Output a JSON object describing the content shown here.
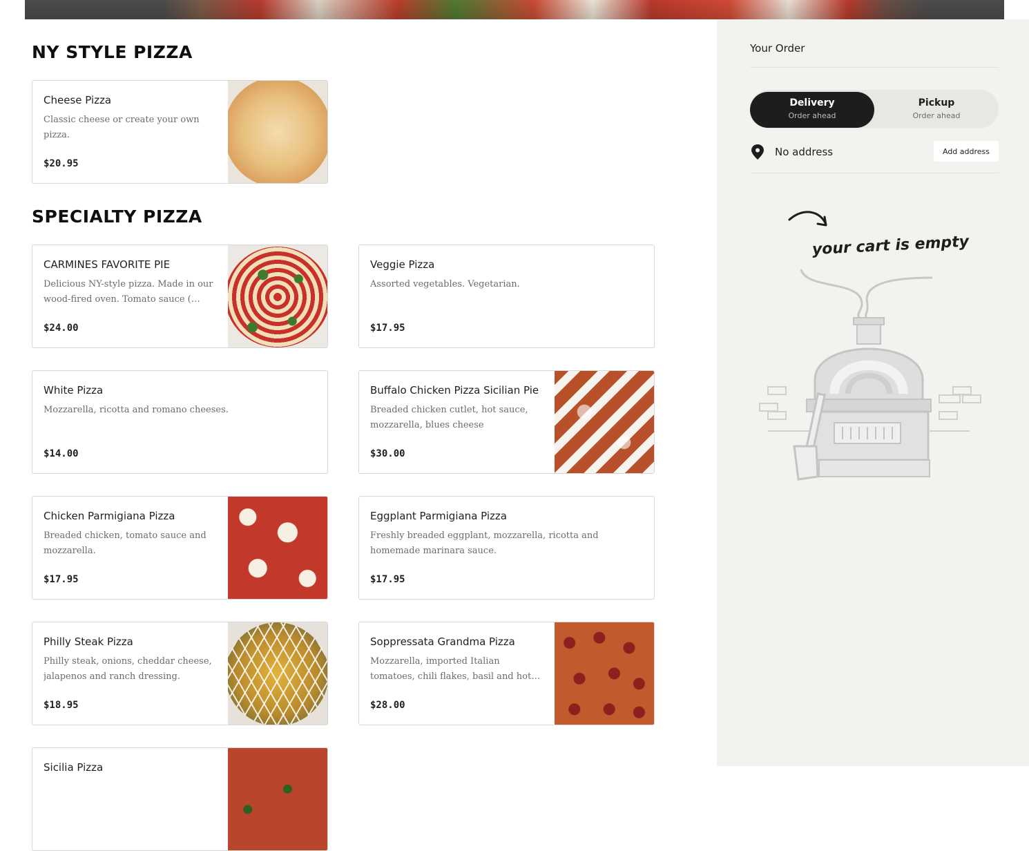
{
  "menu": {
    "sections": [
      {
        "title": "NY STYLE PIZZA",
        "items": [
          {
            "name": "Cheese Pizza",
            "description": "Classic cheese or create your own pizza.",
            "price": "$20.95",
            "image": "cheese-pizza-photo"
          }
        ]
      },
      {
        "title": "SPECIALTY PIZZA",
        "items": [
          {
            "name": "CARMINES FAVORITE PIE",
            "description": "Delicious NY-style pizza. Made in our wood-fired oven. Tomato sauce ( Mutt...",
            "price": "$24.00",
            "image": "carmines-favorite-pie-photo"
          },
          {
            "name": "Veggie Pizza",
            "description": "Assorted vegetables. Vegetarian.",
            "price": "$17.95",
            "image": null
          },
          {
            "name": "White Pizza",
            "description": "Mozzarella, ricotta and romano cheeses.",
            "price": "$14.00",
            "image": null
          },
          {
            "name": "Buffalo Chicken Pizza Sicilian Pie",
            "description": "Breaded chicken cutlet, hot sauce, mozzarella, blues cheese",
            "price": "$30.00",
            "image": "buffalo-chicken-pizza-photo"
          },
          {
            "name": "Chicken Parmigiana Pizza",
            "description": "Breaded chicken, tomato sauce and mozzarella.",
            "price": "$17.95",
            "image": "chicken-parmigiana-pizza-photo"
          },
          {
            "name": "Eggplant Parmigiana Pizza",
            "description": "Freshly breaded eggplant, mozzarella, ricotta and homemade marinara sauce.",
            "price": "$17.95",
            "image": null
          },
          {
            "name": "Philly Steak Pizza",
            "description": "Philly steak, onions, cheddar cheese, jalapenos and ranch dressing.",
            "price": "$18.95",
            "image": "philly-steak-pizza-photo"
          },
          {
            "name": "Soppressata Grandma Pizza",
            "description": "Mozzarella, imported Italian tomatoes, chili flakes, basil and hot soppressata.",
            "price": "$28.00",
            "image": "soppressata-grandma-pizza-photo"
          },
          {
            "name": "Sicilia Pizza",
            "description": "",
            "price": "",
            "image": "sicilia-pizza-photo"
          }
        ]
      }
    ]
  },
  "order": {
    "title": "Your Order",
    "modes": [
      {
        "label": "Delivery",
        "sub": "Order ahead",
        "active": true
      },
      {
        "label": "Pickup",
        "sub": "Order ahead",
        "active": false
      }
    ],
    "address": {
      "text": "No address",
      "button": "Add address",
      "icon": "map-pin-icon"
    },
    "empty_message": "your cart is empty",
    "empty_illustration": "pizza-oven-illustration"
  },
  "colors": {
    "sidebar_bg": "#f3f2ef",
    "active_toggle": "#1d1d1d",
    "card_border": "#d7d7d7",
    "muted_text": "#6b6b6b"
  }
}
